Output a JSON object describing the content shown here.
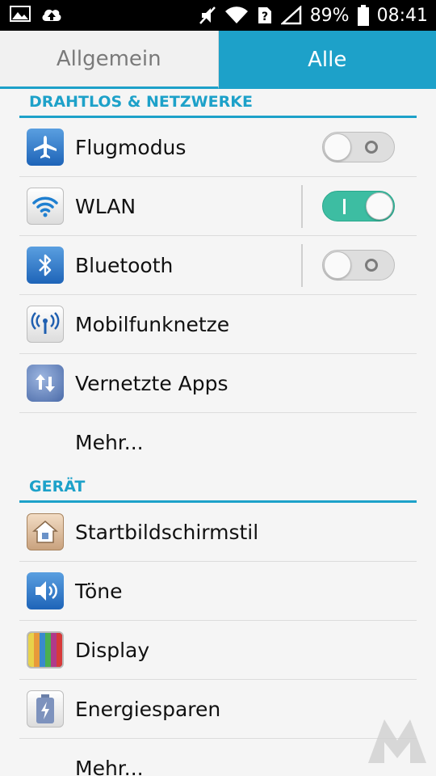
{
  "status_bar": {
    "battery_percent": "89%",
    "time": "08:41",
    "icons": [
      "image-icon",
      "cloud-upload-icon",
      "mute-icon",
      "wifi-icon",
      "sim-unknown-icon",
      "signal-icon",
      "battery-icon"
    ]
  },
  "tabs": [
    {
      "label": "Allgemein",
      "active": false
    },
    {
      "label": "Alle",
      "active": true
    }
  ],
  "sections": {
    "wireless": {
      "title": "DRAHTLOS & NETZWERKE",
      "items": [
        {
          "label": "Flugmodus",
          "icon": "airplane-icon",
          "toggle": "off"
        },
        {
          "label": "WLAN",
          "icon": "wifi-icon",
          "toggle": "on"
        },
        {
          "label": "Bluetooth",
          "icon": "bluetooth-icon",
          "toggle": "off"
        },
        {
          "label": "Mobilfunknetze",
          "icon": "antenna-icon"
        },
        {
          "label": "Vernetzte Apps",
          "icon": "globe-transfer-icon"
        },
        {
          "label": "Mehr...",
          "icon": null
        }
      ]
    },
    "device": {
      "title": "GERÄT",
      "items": [
        {
          "label": "Startbildschirmstil",
          "icon": "home-icon"
        },
        {
          "label": "Töne",
          "icon": "speaker-icon"
        },
        {
          "label": "Display",
          "icon": "display-icon"
        },
        {
          "label": "Energiesparen",
          "icon": "battery-bolt-icon"
        },
        {
          "label": "Mehr...",
          "icon": null
        }
      ]
    }
  },
  "colors": {
    "accent": "#1da1c9",
    "toggle_on": "#3dbda2",
    "background": "#f5f5f5"
  }
}
